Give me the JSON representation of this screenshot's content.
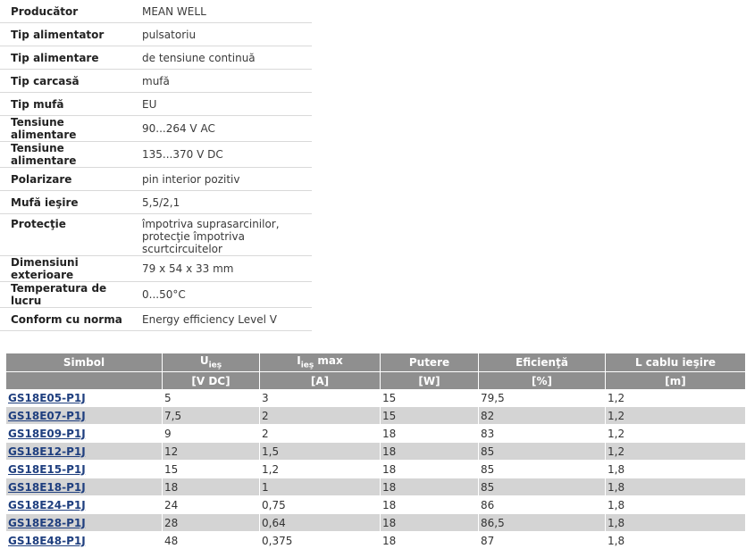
{
  "specs": [
    {
      "key": "Producător",
      "value": [
        "MEAN WELL"
      ]
    },
    {
      "key": "Tip alimentator",
      "value": [
        "pulsatoriu"
      ]
    },
    {
      "key": "Tip alimentare",
      "value": [
        "de tensiune continuă"
      ]
    },
    {
      "key": "Tip carcasă",
      "value": [
        "mufă"
      ]
    },
    {
      "key": "Tip mufă",
      "value": [
        "EU"
      ]
    },
    {
      "key": "Tensiune alimentare",
      "value": [
        "90...264 V AC"
      ]
    },
    {
      "key": "Tensiune alimentare",
      "value": [
        "135...370 V DC"
      ]
    },
    {
      "key": "Polarizare",
      "value": [
        "pin interior pozitiv"
      ]
    },
    {
      "key": "Mufă ieşire",
      "value": [
        "5,5/2,1"
      ]
    },
    {
      "key": "Protecţie",
      "value": [
        "împotriva suprasarcinilor,",
        "protecţie împotriva scurtcircuitelor"
      ]
    },
    {
      "key": "Dimensiuni exterioare",
      "value": [
        "79 x 54 x 33 mm"
      ]
    },
    {
      "key": "Temperatura de lucru",
      "value": [
        "0...50°C"
      ]
    },
    {
      "key": "Conform cu norma",
      "value": [
        "Energy efficiency Level V"
      ]
    }
  ],
  "products": {
    "headers": {
      "symbol": "Simbol",
      "u_main": "U",
      "u_sub": "ieş",
      "i_main": "I",
      "i_sub": "ieş",
      "i_suffix": " max",
      "power": "Putere",
      "eff": "Eficienţă",
      "cable": "L cablu ieşire"
    },
    "units": [
      "",
      "[V DC]",
      "[A]",
      "[W]",
      "[%]",
      "[m]"
    ],
    "rows": [
      [
        "GS18E05-P1J",
        "5",
        "3",
        "15",
        "79,5",
        "1,2"
      ],
      [
        "GS18E07-P1J",
        "7,5",
        "2",
        "15",
        "82",
        "1,2"
      ],
      [
        "GS18E09-P1J",
        "9",
        "2",
        "18",
        "83",
        "1,2"
      ],
      [
        "GS18E12-P1J",
        "12",
        "1,5",
        "18",
        "85",
        "1,2"
      ],
      [
        "GS18E15-P1J",
        "15",
        "1,2",
        "18",
        "85",
        "1,8"
      ],
      [
        "GS18E18-P1J",
        "18",
        "1",
        "18",
        "85",
        "1,8"
      ],
      [
        "GS18E24-P1J",
        "24",
        "0,75",
        "18",
        "86",
        "1,8"
      ],
      [
        "GS18E28-P1J",
        "28",
        "0,64",
        "18",
        "86,5",
        "1,8"
      ],
      [
        "GS18E48-P1J",
        "48",
        "0,375",
        "18",
        "87",
        "1,8"
      ]
    ]
  }
}
